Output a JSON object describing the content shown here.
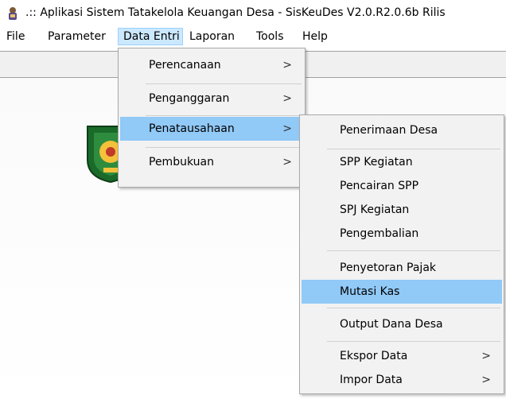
{
  "window": {
    "title": ".:: Aplikasi Sistem Tatakelola Keuangan Desa - SisKeuDes V2.0.R2.0.6b Rilis"
  },
  "menubar": {
    "items": [
      {
        "label": "File"
      },
      {
        "label": "Parameter"
      },
      {
        "label": "Data Entri"
      },
      {
        "label": "Laporan"
      },
      {
        "label": "Tools"
      },
      {
        "label": "Help"
      }
    ]
  },
  "data_entri_menu": {
    "items": [
      {
        "label": "Perencanaan",
        "arrow": ">"
      },
      {
        "label": "Penganggaran",
        "arrow": ">"
      },
      {
        "label": "Penatausahaan",
        "arrow": ">"
      },
      {
        "label": "Pembukuan",
        "arrow": ">"
      }
    ]
  },
  "penatausahaan_menu": {
    "items": [
      {
        "label": "Penerimaan Desa"
      },
      {
        "label": "SPP Kegiatan"
      },
      {
        "label": "Pencairan SPP"
      },
      {
        "label": "SPJ Kegiatan"
      },
      {
        "label": "Pengembalian"
      },
      {
        "label": "Penyetoran Pajak"
      },
      {
        "label": "Mutasi Kas"
      },
      {
        "label": "Output Dana Desa"
      },
      {
        "label": "Ekspor Data",
        "arrow": ">"
      },
      {
        "label": "Impor Data",
        "arrow": ">"
      }
    ]
  },
  "colors": {
    "highlight": "#91c9f7",
    "menu_bg": "#f2f2f2",
    "active_menu": "#cce8ff"
  }
}
